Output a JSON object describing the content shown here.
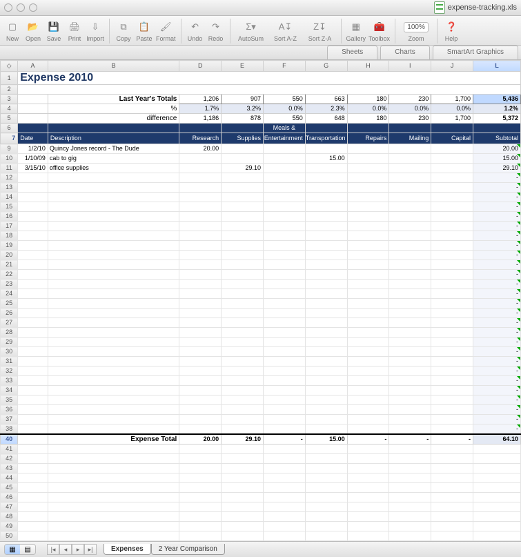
{
  "window": {
    "filename": "expense-tracking.xls"
  },
  "toolbar": {
    "buttons": [
      "New",
      "Open",
      "Save",
      "Print",
      "Import",
      "Copy",
      "Paste",
      "Format",
      "Undo",
      "Redo",
      "AutoSum",
      "Sort A-Z",
      "Sort Z-A",
      "Gallery",
      "Toolbox",
      "Zoom",
      "Help"
    ],
    "zoom_value": "100%"
  },
  "ribbon": {
    "tabs": [
      "Sheets",
      "Charts",
      "SmartArt Graphics"
    ]
  },
  "columns": [
    "A",
    "B",
    "D",
    "E",
    "F",
    "G",
    "H",
    "I",
    "J",
    "L"
  ],
  "sheet": {
    "title": "Expense 2010",
    "summary_label": "Last Year's Totals",
    "pct_label": "%",
    "diff_label": "difference",
    "totals": [
      "1,206",
      "907",
      "550",
      "663",
      "180",
      "230",
      "1,700",
      "5,436"
    ],
    "pcts": [
      "1.7%",
      "3.2%",
      "0.0%",
      "2.3%",
      "0.0%",
      "0.0%",
      "0.0%",
      "1.2%"
    ],
    "diffs": [
      "1,186",
      "878",
      "550",
      "648",
      "180",
      "230",
      "1,700",
      "5,372"
    ],
    "hdr_top": "Meals &",
    "hdr": [
      "Date",
      "Description",
      "Research",
      "Supplies",
      "Entertainment",
      "Transportation",
      "Repairs",
      "Mailing",
      "Capital",
      "Subtotal"
    ],
    "rows": [
      {
        "r": "9",
        "date": "1/2/10",
        "desc": "Quincy Jones record - The Dude",
        "vals": [
          "20.00",
          "",
          "",
          "",
          "",
          "",
          "",
          ""
        ],
        "sub": "20.00"
      },
      {
        "r": "10",
        "date": "1/10/09",
        "desc": "cab to gig",
        "vals": [
          "",
          "",
          "",
          "15.00",
          "",
          "",
          "",
          ""
        ],
        "sub": "15.00"
      },
      {
        "r": "11",
        "date": "3/15/10",
        "desc": "office supplies",
        "vals": [
          "",
          "29.10",
          "",
          "",
          "",
          "",
          "",
          ""
        ],
        "sub": "29.10"
      }
    ],
    "empty_rows": [
      "12",
      "13",
      "14",
      "15",
      "16",
      "17",
      "18",
      "19",
      "20",
      "21",
      "22",
      "23",
      "24",
      "25",
      "26",
      "27",
      "28",
      "29",
      "30",
      "31",
      "32",
      "33",
      "34",
      "35",
      "36",
      "37",
      "38"
    ],
    "total_label": "Expense Total",
    "total_row": "40",
    "totals_expense": [
      "20.00",
      "29.10",
      "-",
      "15.00",
      "-",
      "-",
      "-",
      "64.10"
    ],
    "after_rows": [
      "41",
      "42",
      "43",
      "44",
      "45",
      "46",
      "47",
      "48",
      "49",
      "50"
    ]
  },
  "footer": {
    "tabs": [
      "Expenses",
      "2 Year Comparison"
    ]
  }
}
